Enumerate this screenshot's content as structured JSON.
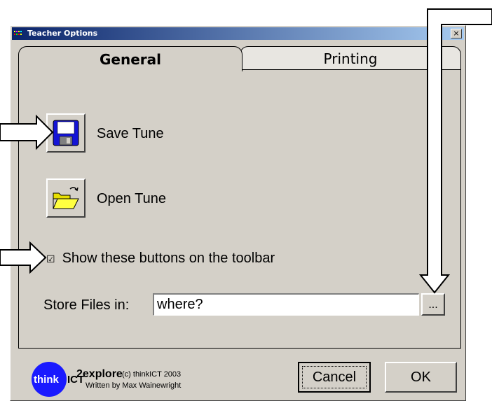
{
  "window": {
    "title": "Teacher Options",
    "close_label": "×"
  },
  "tabs": [
    {
      "label": "General",
      "selected": true
    },
    {
      "label": "Printing",
      "selected": false
    }
  ],
  "general": {
    "save_label": "Save Tune",
    "open_label": "Open Tune",
    "show_buttons_label": "Show these buttons on the toolbar",
    "show_buttons_checked": true,
    "checkbox_mark": "☑",
    "store_label": "Store Files in:",
    "store_value": "where?",
    "browse_label": "..."
  },
  "footer": {
    "logo_text_think": "think",
    "logo_text_ict": "ICT",
    "app_name": "2explore",
    "copyright": "(c) thinkICT 2003",
    "written_by": "Written by Max Wainewright",
    "cancel_label": "Cancel",
    "ok_label": "OK"
  },
  "colors": {
    "dialog_bg": "#d4d0c8",
    "titlebar_start": "#0a246a",
    "titlebar_end": "#a6caf0",
    "logo_blue": "#1a1aff"
  }
}
